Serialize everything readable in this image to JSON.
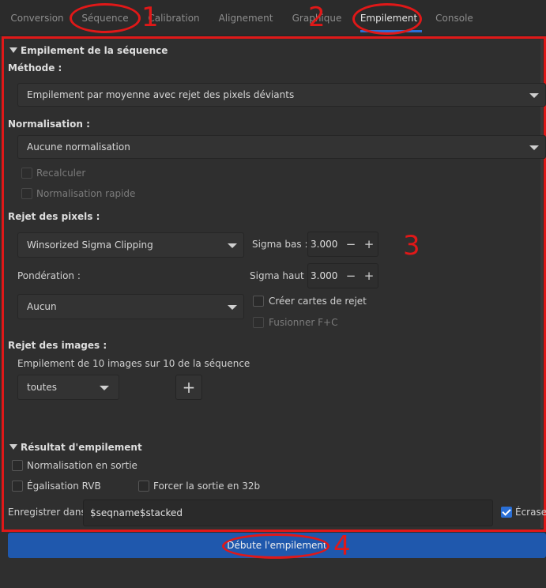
{
  "tabs": [
    {
      "label": "Conversion",
      "active": false
    },
    {
      "label": "Séquence",
      "active": false
    },
    {
      "label": "Calibration",
      "active": false
    },
    {
      "label": "Alignement",
      "active": false
    },
    {
      "label": "Graphique",
      "active": false
    },
    {
      "label": "Empilement",
      "active": true
    },
    {
      "label": "Console",
      "active": false
    }
  ],
  "annotations": {
    "n1": "1",
    "n2": "2",
    "n3": "3",
    "n4": "4"
  },
  "stacking": {
    "title": "Empilement de la séquence",
    "method_label": "Méthode :",
    "method_value": "Empilement par moyenne avec rejet des pixels déviants",
    "normalisation_label": "Normalisation :",
    "normalisation_value": "Aucune normalisation",
    "recalculer": "Recalculer",
    "normalisation_rapide": "Normalisation rapide",
    "pixel_rejection_label": "Rejet des pixels :",
    "rejection_value": "Winsorized Sigma Clipping",
    "sigma_low_label": "Sigma bas :",
    "sigma_low_value": "3.000",
    "sigma_high_label": "Sigma haut :",
    "sigma_high_value": "3.000",
    "weighting_label": "Pondération :",
    "weighting_value": "Aucun",
    "rejection_maps": "Créer cartes de rejet",
    "merge_fc": "Fusionner F+C",
    "image_rejection_label": "Rejet des images :",
    "image_rejection_info": "Empilement de 10 images sur 10 de la séquence",
    "image_rejection_value": "toutes"
  },
  "result": {
    "title": "Résultat d'empilement",
    "output_norm": "Normalisation en sortie",
    "rgb_eq": "Égalisation RVB",
    "force_32b": "Forcer la sortie en 32b",
    "save_label": "Enregistrer dans :",
    "save_value": "$seqname$stacked",
    "overwrite": "Écraser",
    "overwrite_checked": true
  },
  "start_button": "Débute l'empilement",
  "colors": {
    "accent": "#2a6fd6",
    "annotation": "#e01818",
    "start_button": "#1f58ad"
  }
}
